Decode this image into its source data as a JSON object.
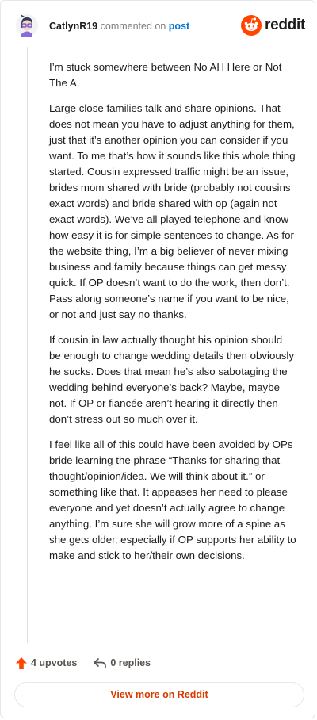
{
  "header": {
    "username": "CatlynR19",
    "commented_text": "commented on",
    "post_link": "post",
    "brand": "reddit"
  },
  "colors": {
    "brand_orange": "#ff4500",
    "link_blue": "#0079d3",
    "view_more": "#d93a00"
  },
  "comment": {
    "paragraphs": [
      "I’m stuck somewhere between No AH Here or Not The A.",
      "Large close families talk and share opinions. That does not mean you have to adjust anything for them, just that it’s another opinion you can consider if you want. To me that’s how it sounds like this whole thing started. Cousin expressed traffic might be an issue, brides mom shared with bride (probably not cousins exact words) and bride shared with op (again not exact words). We’ve all played telephone and know how easy it is for simple sentences to change. As for the website thing, I’m a big believer of never mixing business and family because things can get messy quick. If OP doesn’t want to do the work, then don’t. Pass along someone’s name if you want to be nice, or not and just say no thanks.",
      "If cousin in law actually thought his opinion should be enough to change wedding details then obviously he sucks. Does that mean he’s also sabotaging the wedding behind everyone’s back? Maybe, maybe not. If OP or fiancée aren’t hearing it directly then don’t stress out so much over it.",
      "I feel like all of this could have been avoided by OPs bride learning the phrase “Thanks for sharing that thought/opinion/idea. We will think about it.” or something like that. It appeases her need to please everyone and yet doesn’t actually agree to change anything. I’m sure she will grow more of a spine as she gets older, especially if OP supports her ability to make and stick to her/their own decisions."
    ]
  },
  "actions": {
    "upvotes": "4 upvotes",
    "replies": "0 replies"
  },
  "footer": {
    "view_more": "View more on Reddit"
  },
  "icons": [
    "avatar",
    "reddit-logo-icon",
    "upvote-icon",
    "reply-icon"
  ]
}
